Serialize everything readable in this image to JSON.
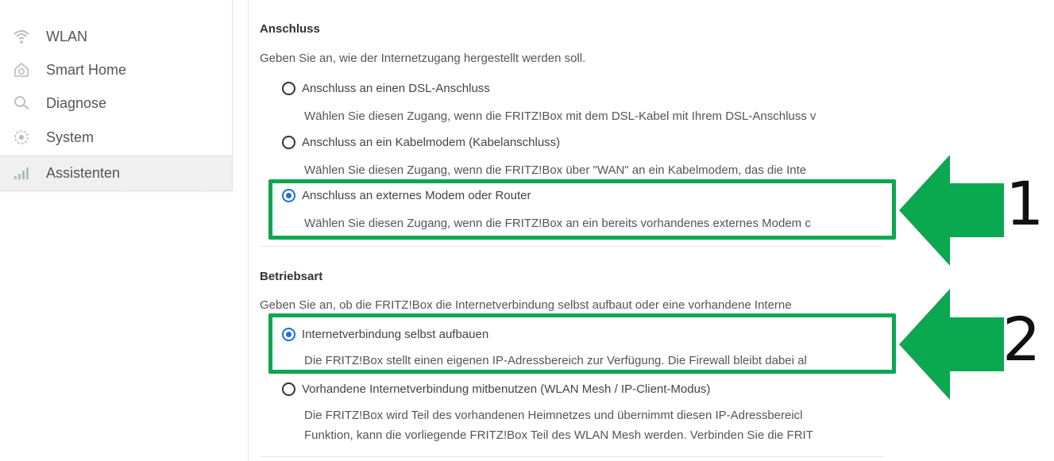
{
  "sidebar": {
    "items": [
      {
        "label": "WLAN",
        "icon": "wifi-icon"
      },
      {
        "label": "Smart Home",
        "icon": "smart-home-icon"
      },
      {
        "label": "Diagnose",
        "icon": "magnifier-icon"
      },
      {
        "label": "System",
        "icon": "system-icon"
      },
      {
        "label": "Assistenten",
        "icon": "wizard-icon"
      }
    ]
  },
  "anschluss": {
    "title": "Anschluss",
    "intro": "Geben Sie an, wie der Internetzugang hergestellt werden soll.",
    "options": [
      {
        "label": "Anschluss an einen DSL-Anschluss",
        "desc": "Wählen Sie diesen Zugang, wenn die FRITZ!Box mit dem DSL-Kabel mit Ihrem DSL-Anschluss v",
        "checked": false
      },
      {
        "label": "Anschluss an ein Kabelmodem (Kabelanschluss)",
        "desc": "Wählen Sie diesen Zugang, wenn die FRITZ!Box über \"WAN\" an ein Kabelmodem, das die Inte",
        "checked": false
      },
      {
        "label": "Anschluss an externes Modem oder Router",
        "desc": "Wählen Sie diesen Zugang, wenn die FRITZ!Box an ein bereits vorhandenes externes Modem c",
        "checked": true
      }
    ]
  },
  "betriebsart": {
    "title": "Betriebsart",
    "intro": "Geben Sie an, ob die FRITZ!Box die Internetverbindung selbst aufbaut oder eine vorhandene Interne",
    "options": [
      {
        "label": "Internetverbindung selbst aufbauen",
        "desc": "Die FRITZ!Box stellt einen eigenen IP-Adressbereich zur Verfügung. Die Firewall bleibt dabei al",
        "checked": true
      },
      {
        "label": "Vorhandene Internetverbindung mitbenutzen (WLAN Mesh / IP-Client-Modus)",
        "desc": "Die FRITZ!Box wird Teil des vorhandenen Heimnetzes und übernimmt diesen IP-Adressbereicl",
        "desc2": "Funktion, kann die vorliegende FRITZ!Box Teil des WLAN Mesh werden. Verbinden Sie die FRIT",
        "checked": false
      }
    ]
  },
  "annotations": {
    "marker1": "1",
    "marker2": "2",
    "color": "#0aa84f"
  }
}
